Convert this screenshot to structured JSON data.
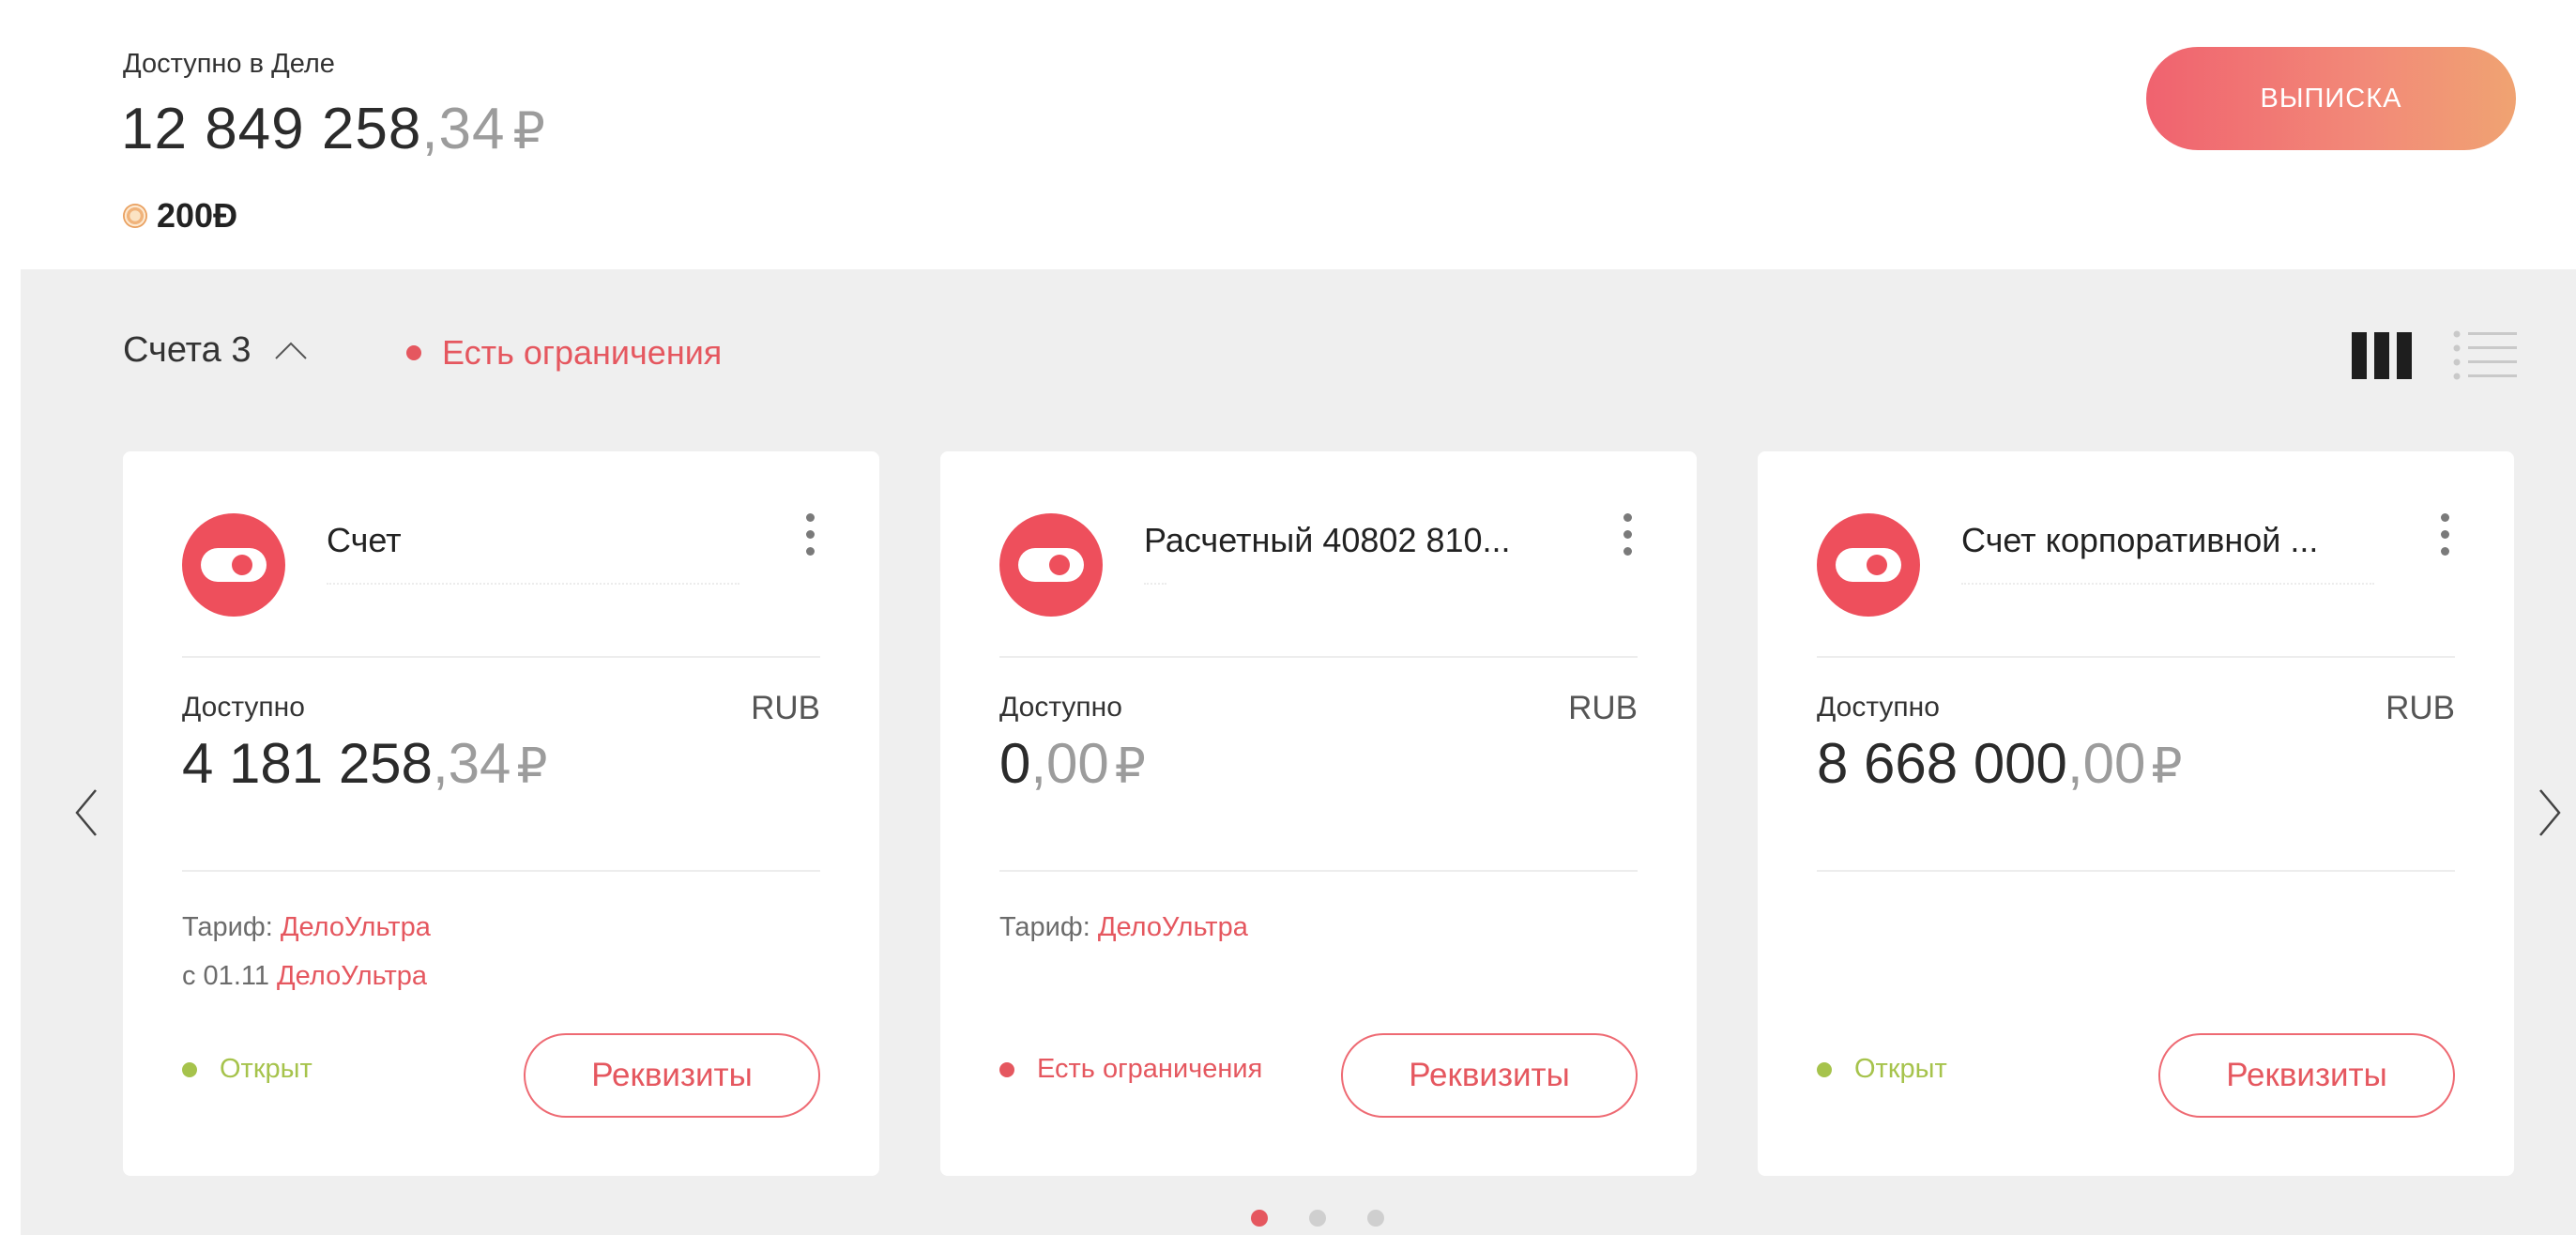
{
  "summary": {
    "available_label": "Доступно в Деле",
    "balance_int": "12 849 258",
    "balance_frac": ",34",
    "currency_symbol": "₽",
    "coins_value": "200",
    "coins_symbol": "Ɖ",
    "statement_button": "ВЫПИСКА"
  },
  "accounts": {
    "header_label": "Счета",
    "count": "3",
    "restriction_label": "Есть ограничения"
  },
  "cards": [
    {
      "title": "Счет",
      "available_label": "Доступно",
      "currency": "RUB",
      "amount_int": "4 181 258",
      "amount_frac": ",34",
      "currency_symbol": "₽",
      "tariff_label": "Тариф:",
      "tariff_name": "ДелоУльтра",
      "tariff_next_label": "с 01.11",
      "tariff_next_name": "ДелоУльтра",
      "status": "Открыт",
      "details_button": "Реквизиты"
    },
    {
      "title": "Расчетный 40802 810...",
      "available_label": "Доступно",
      "currency": "RUB",
      "amount_int": "0",
      "amount_frac": ",00",
      "currency_symbol": "₽",
      "tariff_label": "Тариф:",
      "tariff_name": "ДелоУльтра",
      "status": "Есть ограничения",
      "details_button": "Реквизиты"
    },
    {
      "title": "Счет корпоративной ...",
      "available_label": "Доступно",
      "currency": "RUB",
      "amount_int": "8 668 000",
      "amount_frac": ",00",
      "currency_symbol": "₽",
      "status": "Открыт",
      "details_button": "Реквизиты"
    }
  ],
  "carousel": {
    "pages": 3,
    "active_page": 1
  },
  "colors": {
    "accent": "#e5575f",
    "open_status": "#a6c34c",
    "background_grey": "#efefef"
  },
  "icons": {
    "coin": "coin-icon",
    "collapse": "chevron-up-icon",
    "grid_view": "grid-view-icon",
    "list_view": "list-view-icon",
    "account": "toggle-icon",
    "menu": "kebab-menu-icon",
    "prev": "chevron-left-icon",
    "next": "chevron-right-icon"
  }
}
